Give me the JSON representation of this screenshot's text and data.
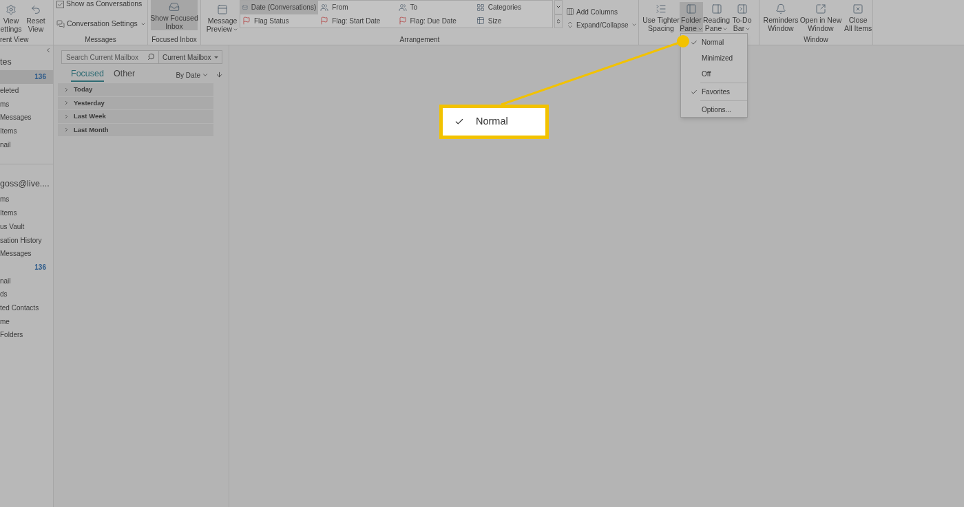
{
  "ribbon": {
    "current_view": {
      "label": "rent View",
      "buttons": [
        {
          "lines": [
            "View",
            "ettings"
          ]
        },
        {
          "lines": [
            "Reset",
            "View"
          ]
        }
      ]
    },
    "messages": {
      "label": "Messages",
      "show_as_conversations": {
        "label": "Show as Conversations",
        "checked": true
      },
      "conversation_settings": {
        "label": "Conversation Settings",
        "dropdown": true
      }
    },
    "focused_inbox": {
      "label": "Focused Inbox",
      "button": {
        "lines": [
          "Show Focused",
          "Inbox"
        ],
        "selected": true
      }
    },
    "arrangement": {
      "label": "Arrangement",
      "message_preview": {
        "lines": [
          "Message",
          "Preview"
        ],
        "dropdown": true
      },
      "gallery": [
        {
          "label": "Date (Conversations)",
          "selected": true
        },
        {
          "label": "From",
          "selected": false
        },
        {
          "label": "To",
          "selected": false
        },
        {
          "label": "Categories",
          "selected": false
        },
        {
          "label": "Flag Status",
          "selected": false
        },
        {
          "label": "Flag: Start Date",
          "selected": false
        },
        {
          "label": "Flag: Due Date",
          "selected": false
        },
        {
          "label": "Size",
          "selected": false
        }
      ],
      "commands": [
        {
          "label": "Add Columns",
          "dropdown": false
        },
        {
          "label": "Expand/Collapse",
          "dropdown": true
        }
      ]
    },
    "layout": {
      "buttons": [
        {
          "lines": [
            "Use Tighter",
            "Spacing"
          ],
          "selected": false,
          "dropdown": false
        },
        {
          "lines": [
            "Folder",
            "Pane"
          ],
          "selected": true,
          "dropdown": true
        },
        {
          "lines": [
            "Reading",
            "Pane"
          ],
          "selected": false,
          "dropdown": true
        },
        {
          "lines": [
            "To-Do",
            "Bar"
          ],
          "selected": false,
          "dropdown": true
        }
      ]
    },
    "window": {
      "label": "Window",
      "buttons": [
        {
          "lines": [
            "Reminders",
            "Window"
          ]
        },
        {
          "lines": [
            "Open in New",
            "Window"
          ]
        },
        {
          "lines": [
            "Close",
            "All Items"
          ]
        }
      ]
    }
  },
  "folder_pane": {
    "items": [
      {
        "kind": "header",
        "label": "tes"
      },
      {
        "kind": "item",
        "count": "136",
        "selected": true
      },
      {
        "kind": "item",
        "label": "eleted",
        "selected": false
      },
      {
        "kind": "item",
        "label": "ms",
        "selected": false
      },
      {
        "kind": "item",
        "label": "Messages",
        "selected": false
      },
      {
        "kind": "item",
        "label": "Items",
        "selected": false
      },
      {
        "kind": "item",
        "label": "nail",
        "selected": false
      },
      {
        "kind": "account",
        "label": "goss@live...."
      },
      {
        "kind": "item",
        "label": "ms",
        "selected": false
      },
      {
        "kind": "item",
        "label": "Items",
        "selected": false
      },
      {
        "kind": "item",
        "label": "us Vault",
        "selected": false
      },
      {
        "kind": "item",
        "label": "sation History",
        "selected": false
      },
      {
        "kind": "item",
        "label": "Messages",
        "selected": false
      },
      {
        "kind": "item",
        "count": "136",
        "selected": false
      },
      {
        "kind": "item",
        "label": "nail",
        "selected": false
      },
      {
        "kind": "item",
        "label": "ds",
        "selected": false
      },
      {
        "kind": "item",
        "label": "ted Contacts",
        "selected": false
      },
      {
        "kind": "item",
        "label": "me",
        "selected": false
      },
      {
        "kind": "item",
        "label": "Folders",
        "selected": false
      }
    ]
  },
  "message_list": {
    "search": {
      "placeholder": "Search Current Mailbox"
    },
    "scope": "Current Mailbox",
    "tabs": [
      {
        "label": "Focused",
        "selected": true
      },
      {
        "label": "Other",
        "selected": false
      }
    ],
    "sort": "By Date",
    "groups": [
      {
        "label": "Today",
        "expanded": false
      },
      {
        "label": "Yesterday",
        "expanded": false
      },
      {
        "label": "Last Week",
        "expanded": false
      },
      {
        "label": "Last Month",
        "expanded": false
      }
    ]
  },
  "folder_pane_menu": {
    "items": [
      {
        "kind": "option",
        "label": "Normal",
        "checked": true
      },
      {
        "kind": "option",
        "label": "Minimized",
        "checked": false
      },
      {
        "kind": "option",
        "label": "Off",
        "checked": false
      },
      {
        "kind": "separator"
      },
      {
        "kind": "option",
        "label": "Favorites",
        "checked": true
      },
      {
        "kind": "separator"
      },
      {
        "kind": "option",
        "label": "Options...",
        "checked": false
      }
    ]
  },
  "callout": {
    "label": "Normal",
    "checked": true
  }
}
